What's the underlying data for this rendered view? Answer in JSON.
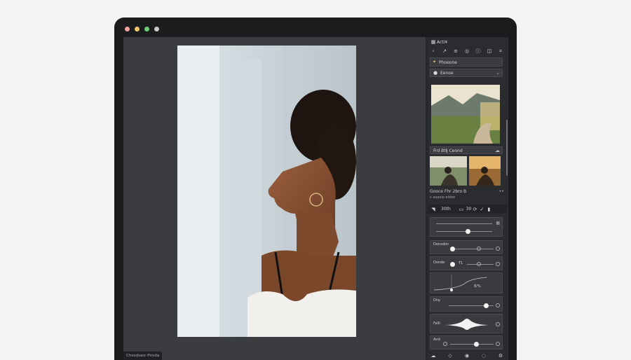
{
  "window": {
    "controls": [
      {
        "name": "close",
        "color": "#f4a3a0"
      },
      {
        "name": "minimize",
        "color": "#f2c56b"
      },
      {
        "name": "zoom",
        "color": "#6bcf7a"
      },
      {
        "name": "extra",
        "color": "#c9c9cc"
      }
    ]
  },
  "status": {
    "text": "Chesdsasr Piroda"
  },
  "panel": {
    "title": "Acti¥",
    "section": "Phoeone",
    "dropdown": "Eenoe",
    "album_label": "Frd Bt§ Ceond",
    "preset_title": "Gooce Fhr 2bro B",
    "preset_sub": "s aaaoio eldoe",
    "tool_label": "30th",
    "tool_value": "30",
    "sliders": {
      "s1": "Densdon",
      "s2": "Donde",
      "s2_value": "T1",
      "curve_value": "8/%",
      "s3": "Dny",
      "s4": "FaIll",
      "s5": "And"
    }
  },
  "icons": [
    "back-icon",
    "share-icon",
    "layers-icon",
    "adjust-icon",
    "info-icon",
    "compare-icon",
    "crop-icon"
  ]
}
